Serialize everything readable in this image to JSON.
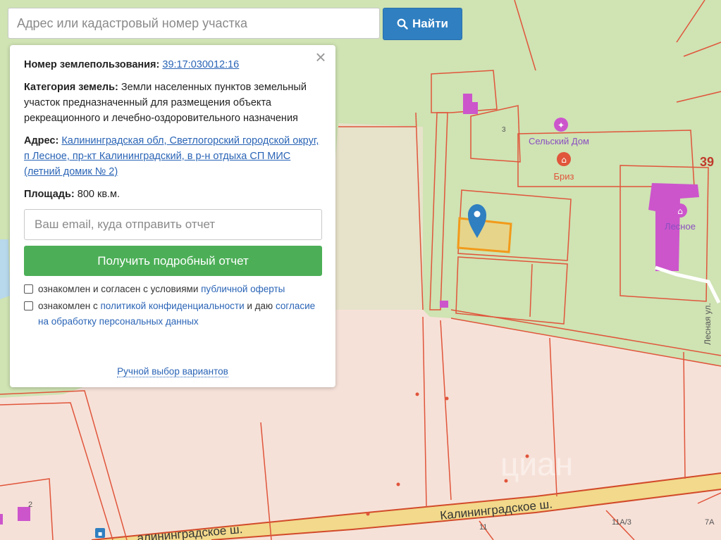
{
  "search": {
    "placeholder": "Адрес или кадастровый номер участка",
    "value": "",
    "button_label": "Найти"
  },
  "popup": {
    "close_label": "×",
    "number_label": "Номер землепользования:",
    "number_value": "39:17:030012:16",
    "category_label": "Категория земель:",
    "category_value": "Земли населенных пунктов земельный участок предназначенный для размещения объекта рекреационного и лечебно-оздоровительного назначения",
    "address_label": "Адрес:",
    "address_value": "Калининградская обл, Светлогорский городской округ, п Лесное, пр-кт Калининградский, в р-н отдыха СП МИС (летний домик № 2)",
    "area_label": "Площадь:",
    "area_value": "800 кв.м.",
    "email_placeholder": "Ваш email, куда отправить отчет",
    "email_value": "",
    "report_button": "Получить подробный отчет",
    "consent1_text": "ознакомлен и согласен с условиями ",
    "consent1_link": "публичной оферты",
    "consent2_text": "ознакомлен с ",
    "consent2_link": "политикой конфиденциальности",
    "consent2_and": " и даю ",
    "consent2_link2": "согласие на обработку персональных данных",
    "manual_link": "Ручной выбор вариантов"
  },
  "map": {
    "labels": {
      "selskiy_dom": "Сельский Дом",
      "briz": "Бриз",
      "lesnoe": "Лесное",
      "lesnaya_ul": "Лесная ул.",
      "kaliningradskoe_sh": "Калининградское ш.",
      "kaliningradskoe_sh_2": "алининградское ш.",
      "parcel_39": "39",
      "house_3": "3",
      "house_11": "11",
      "house_11a3": "11А/3",
      "house_7a": "7А",
      "house_2": "2",
      "watermark": "циан"
    },
    "colors": {
      "forest": "#cfe3b3",
      "land": "#f6e1d8",
      "parcel_line": "#e0553b",
      "building": "#cc55cc",
      "selected_parcel": "#e6d48a",
      "selected_border": "#f29a1a",
      "marker": "#2f7fc1",
      "road": "#f2d98b"
    }
  }
}
